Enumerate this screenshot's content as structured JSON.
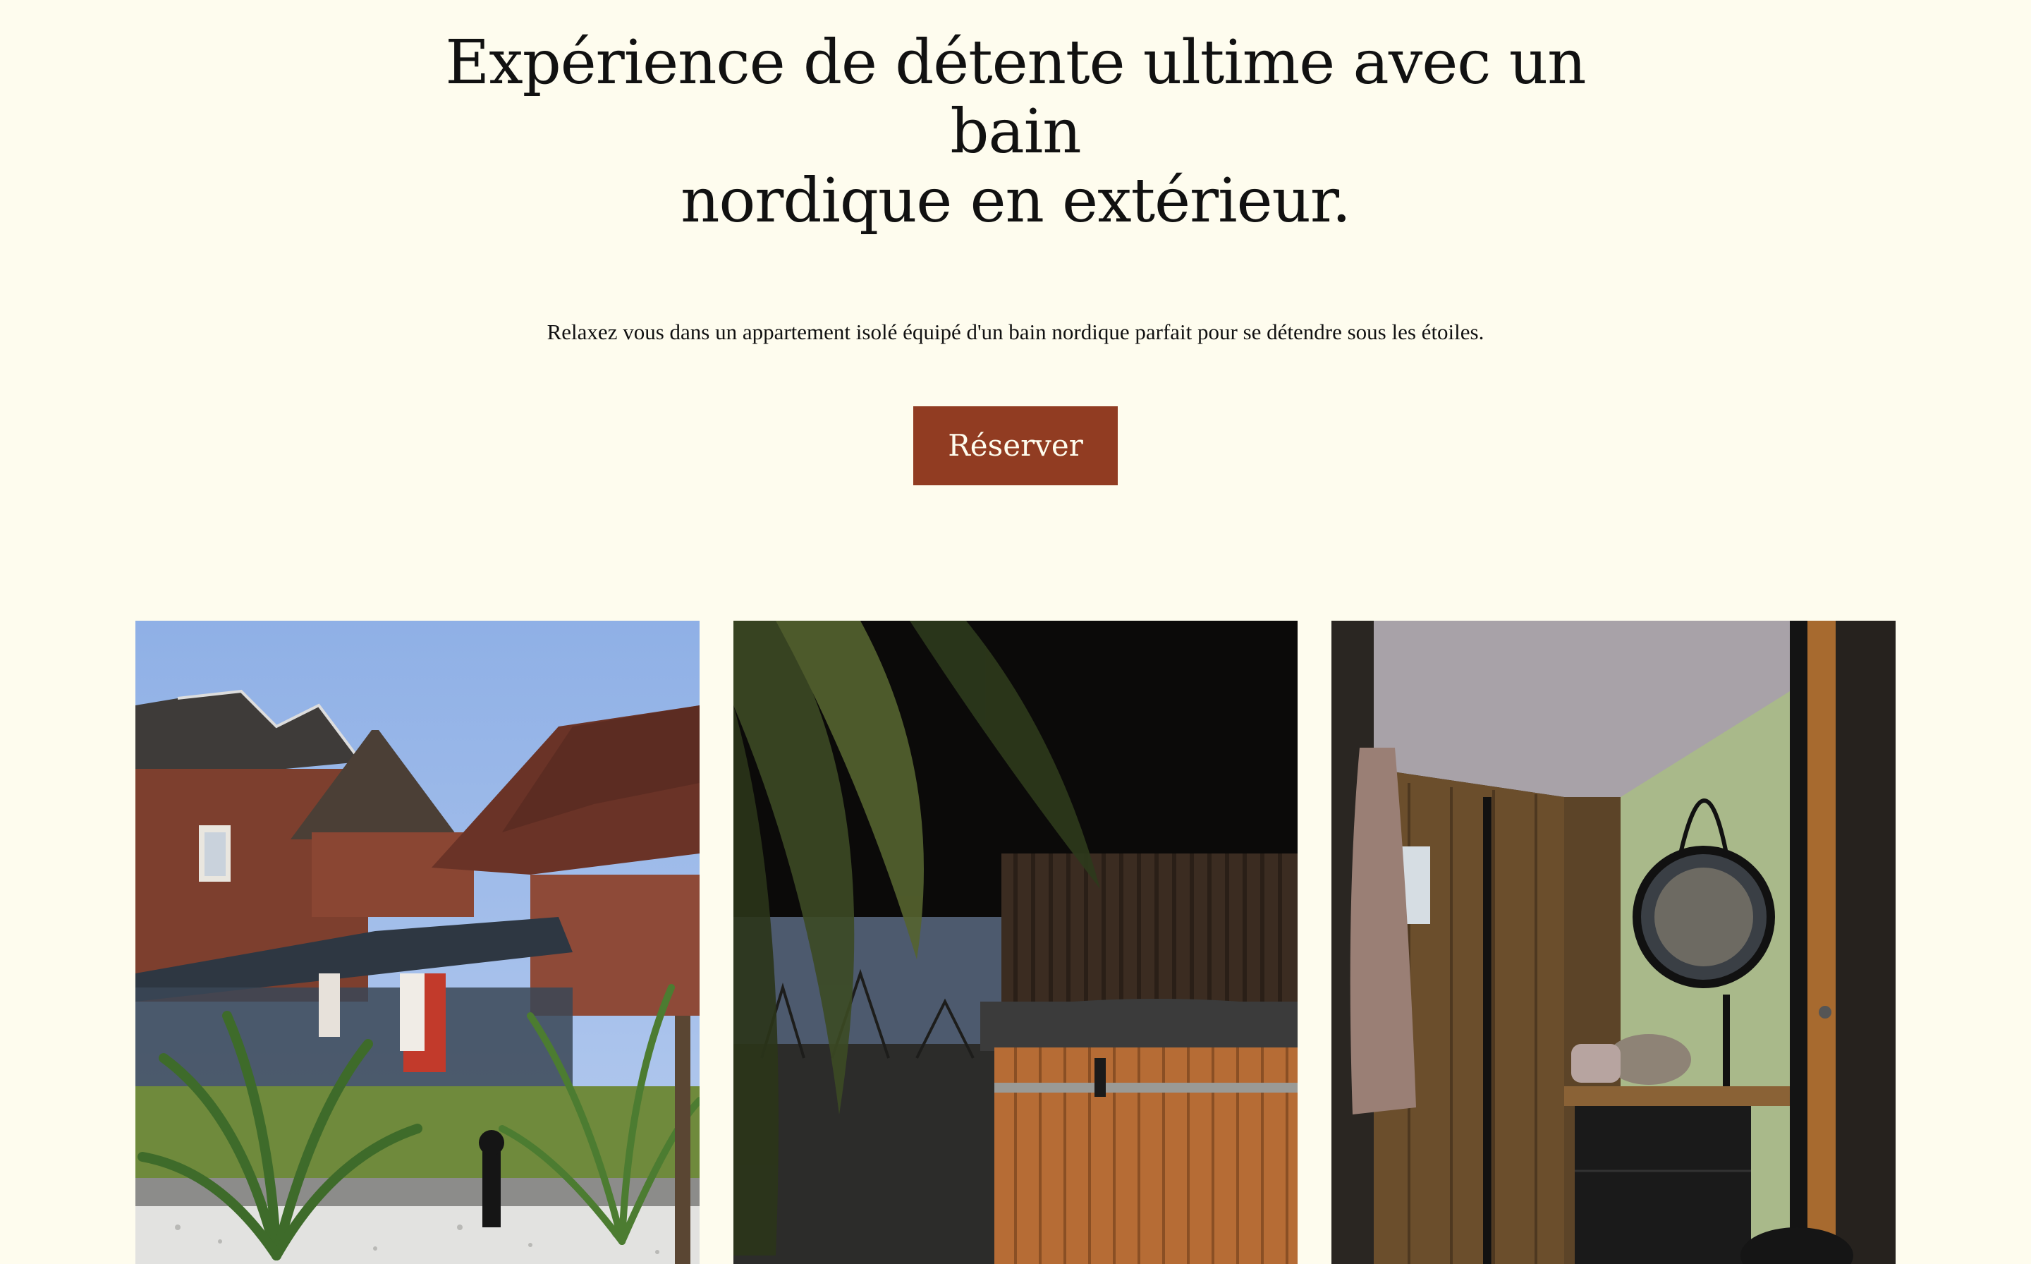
{
  "hero": {
    "title_line1": "Expérience de détente ultime avec un bain",
    "title_line2": "nordique en extérieur.",
    "subtitle": "Relaxez vous dans un appartement isolé équipé d'un bain nordique parfait pour se détendre sous les étoiles.",
    "cta_label": "Réserver"
  },
  "colors": {
    "background": "#fefcee",
    "accent": "#913c22",
    "text": "#111111"
  },
  "gallery": {
    "images": [
      {
        "name": "house-garden-photo"
      },
      {
        "name": "nordic-bath-tub-photo"
      },
      {
        "name": "bathroom-shower-photo"
      }
    ]
  }
}
